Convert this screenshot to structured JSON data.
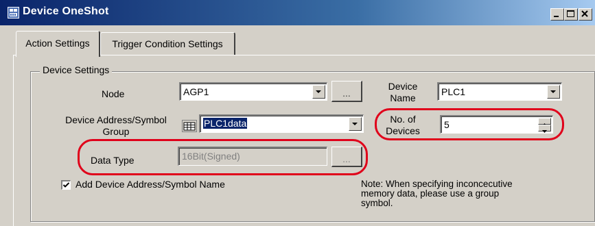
{
  "window": {
    "title": "Device OneShot",
    "icon": "device-oneshot-icon"
  },
  "tabs": [
    {
      "label": "Action Settings",
      "active": true
    },
    {
      "label": "Trigger Condition Settings",
      "active": false
    }
  ],
  "group": {
    "label": "Device Settings"
  },
  "node": {
    "label": "Node",
    "value": "AGP1",
    "browse": "..."
  },
  "device_name": {
    "label_line1": "Device",
    "label_line2": "Name",
    "value": "PLC1"
  },
  "address": {
    "label_line1": "Device Address/Symbol",
    "label_line2": "Group",
    "value": "PLC1data"
  },
  "no_devices": {
    "label_line1": "No. of",
    "label_line2": "Devices",
    "value": "5"
  },
  "data_type": {
    "label": "Data Type",
    "value": "16Bit(Signed)",
    "browse": "..."
  },
  "add_name": {
    "label": "Add Device Address/Symbol Name",
    "checked": true
  },
  "note": {
    "line1": "Note: When specifying inconcecutive",
    "line2": "memory data, please use a group",
    "line3": "symbol."
  },
  "colors": {
    "highlight": "#e0001a",
    "title_bar": "#0a246a",
    "selection": "#0a246a"
  }
}
